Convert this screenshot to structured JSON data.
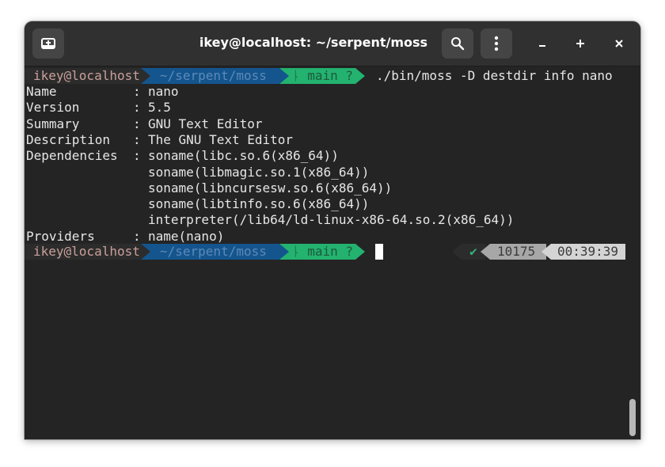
{
  "window": {
    "title": "ikey@localhost: ~/serpent/moss"
  },
  "titlebar": {
    "new_tab_icon": "new-tab-icon",
    "search_icon": "search-icon",
    "menu_icon": "vertical-ellipsis-icon",
    "minimize_label": "–",
    "maximize_label": "+",
    "close_label": "×"
  },
  "prompt": {
    "host": "ikey@localhost",
    "dir": "~/serpent/moss",
    "git_icon": "ᚿ",
    "git": " main ?"
  },
  "command": "./bin/moss -D destdir info nano",
  "output": [
    {
      "label": "Name",
      "sep": ":",
      "value": "nano"
    },
    {
      "label": "Version",
      "sep": ":",
      "value": "5.5"
    },
    {
      "label": "Summary",
      "sep": ":",
      "value": "GNU Text Editor"
    },
    {
      "label": "Description",
      "sep": ":",
      "value": "The GNU Text Editor"
    },
    {
      "label": "Dependencies",
      "sep": ":",
      "value": "soname(libc.so.6(x86_64))"
    },
    {
      "label": "",
      "sep": "",
      "value": "soname(libmagic.so.1(x86_64))"
    },
    {
      "label": "",
      "sep": "",
      "value": "soname(libncursesw.so.6(x86_64))"
    },
    {
      "label": "",
      "sep": "",
      "value": "soname(libtinfo.so.6(x86_64))"
    },
    {
      "label": "",
      "sep": "",
      "value": "interpreter(/lib64/ld-linux-x86-64.so.2(x86_64))"
    },
    {
      "label": "Providers",
      "sep": ":",
      "value": "name(nano)"
    }
  ],
  "right_prompt": {
    "status": "✔",
    "pid": "10175",
    "time": "00:39:39"
  },
  "colors": {
    "terminal_bg": "#242424",
    "titlebar_bg": "#303030",
    "host_bg": "#2c2c2c",
    "dir_bg": "#14558e",
    "git_bg": "#23b26f"
  }
}
